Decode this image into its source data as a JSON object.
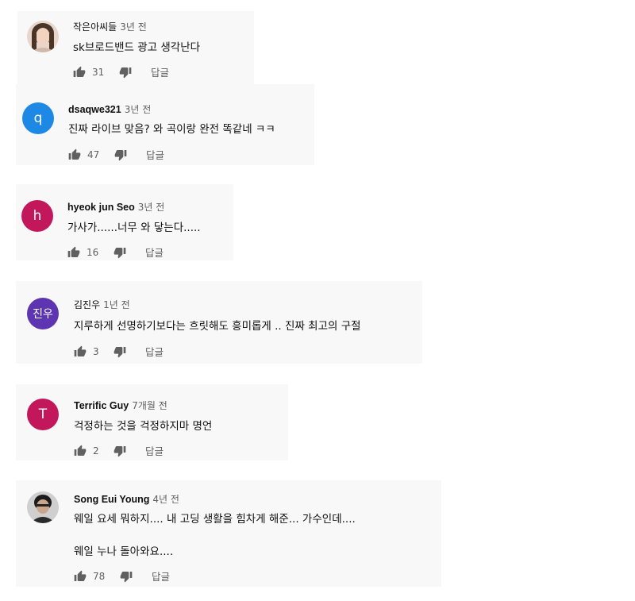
{
  "comments": [
    {
      "author": "작은아씨들",
      "time": "3년 전",
      "text": "sk브로드밴드 광고 생각난다",
      "likes": "31",
      "reply": "답글",
      "avatar": {
        "type": "photo",
        "color": "#d9b8a6"
      }
    },
    {
      "author": "dsaqwe321",
      "time": "3년 전",
      "text": "진짜 라이브 맞음? 와 곡이랑 완전 똑같네 ㅋㅋ",
      "likes": "47",
      "reply": "답글",
      "avatar": {
        "type": "letter",
        "letter": "q",
        "color": "#1e88e5"
      }
    },
    {
      "author": "hyeok jun Seo",
      "time": "3년 전",
      "text": "가사가......너무 와 닿는다.....",
      "likes": "16",
      "reply": "답글",
      "avatar": {
        "type": "letter",
        "letter": "h",
        "color": "#c2185b"
      }
    },
    {
      "author": "김진우",
      "time": "1년 전",
      "text": "지루하게 선명하기보다는 흐릿해도 흥미롭게 .. 진짜 최고의 구절",
      "likes": "3",
      "reply": "답글",
      "avatar": {
        "type": "letter",
        "letter": "진우",
        "color": "#5e35b1"
      }
    },
    {
      "author": "Terrific Guy",
      "time": "7개월 전",
      "text": "걱정하는 것을 걱정하지마 명언",
      "likes": "2",
      "reply": "답글",
      "avatar": {
        "type": "letter",
        "letter": "T",
        "color": "#c2185b"
      }
    },
    {
      "author": "Song Eui Young",
      "time": "4년 전",
      "text": "웨일 요세 뭐하지.... 내 고딩 생활을 힘차게 해준... 가수인데....",
      "text2": "웨일 누나 돌아와요....",
      "likes": "78",
      "reply": "답글",
      "avatar": {
        "type": "photo",
        "color": "#3a3a3a"
      }
    }
  ]
}
